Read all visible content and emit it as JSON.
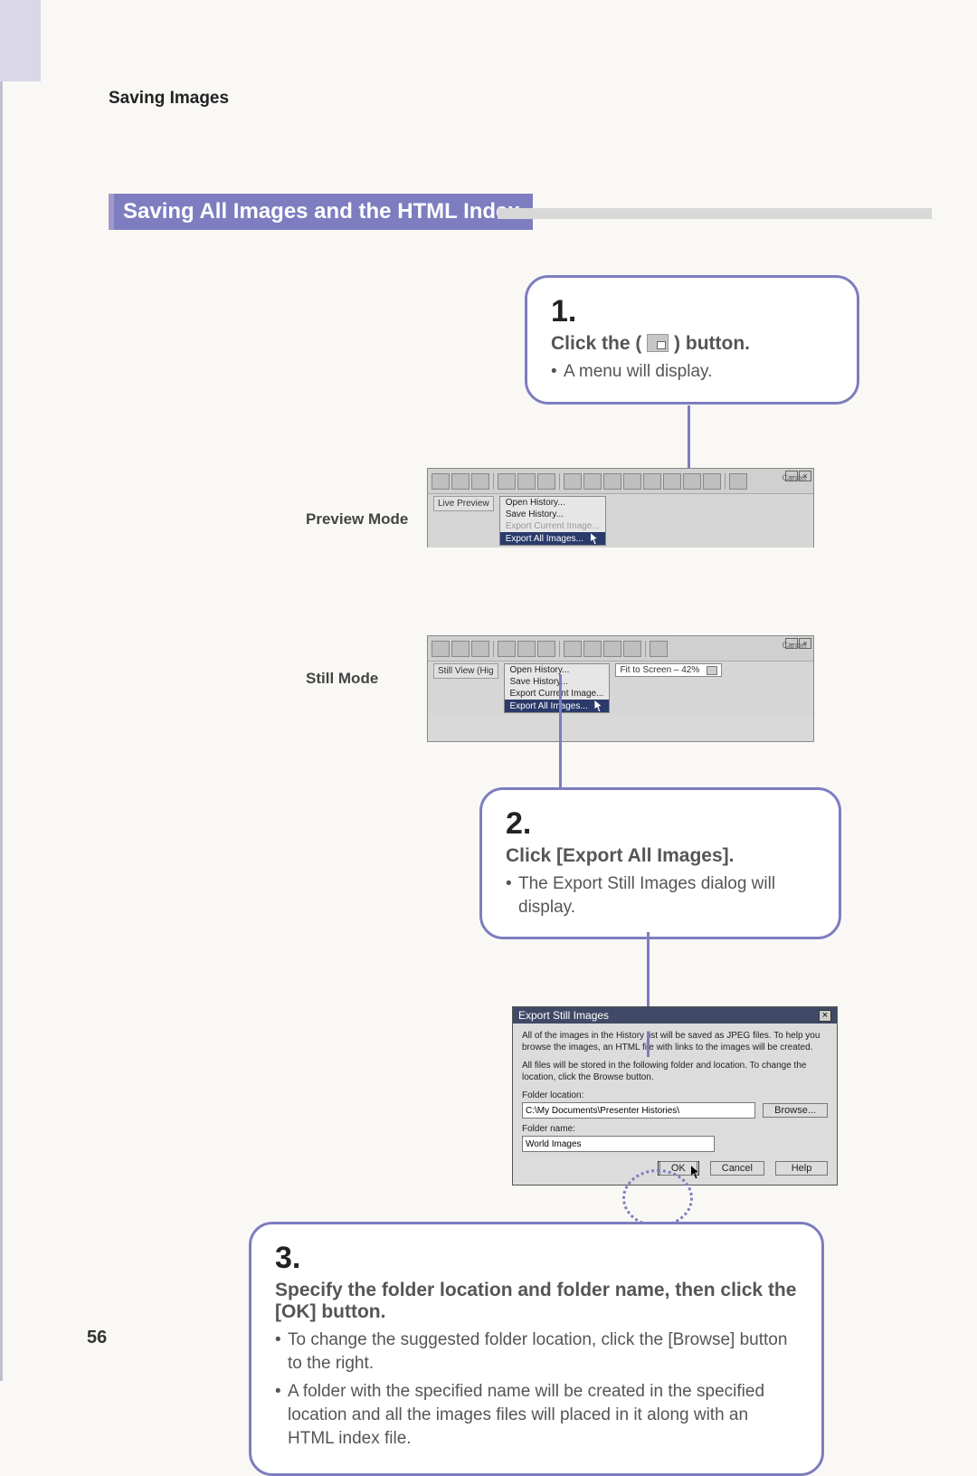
{
  "header_label": "Saving Images",
  "section_title": "Saving All Images and the HTML Index",
  "page_number": "56",
  "step1": {
    "num": "1.",
    "title_pre": "Click the ( ",
    "title_post": " ) button.",
    "bullet": "A menu will display."
  },
  "step2": {
    "num": "2.",
    "title": "Click [Export All Images].",
    "bullet": "The Export Still Images dialog will display."
  },
  "step3": {
    "num": "3.",
    "title": "Specify the folder location and folder name, then click the [OK] button.",
    "b1": "To change the suggested folder location, click the [Browse] button to the right.",
    "b2": "A folder with the specified name will be created in the specified location and all the images files will placed in it along with an HTML index file."
  },
  "mode_labels": {
    "preview": "Preview Mode",
    "still": "Still Mode"
  },
  "toolbar_preview": {
    "brand": "Canon",
    "mode_button": "Live Preview",
    "menu": {
      "open_history": "Open History...",
      "save_history": "Save History...",
      "export_current": "Export Current Image...",
      "export_all": "Export All Images..."
    }
  },
  "toolbar_still": {
    "brand": "Canon",
    "mode_button": "Still View (Hig",
    "fit_label": "Fit to Screen – 42%",
    "menu": {
      "open_history": "Open History...",
      "save_history": "Save History...",
      "export_current": "Export Current Image...",
      "export_all": "Export All Images..."
    }
  },
  "dialog": {
    "title": "Export Still Images",
    "para1": "All of the images in the History list will be saved as JPEG files. To help you browse the images, an HTML file with links to the images will be created.",
    "para2": "All files will be stored in the following folder and location. To change the location, click the Browse button.",
    "folder_location_label": "Folder location:",
    "folder_location_value": "C:\\My Documents\\Presenter Histories\\",
    "browse": "Browse...",
    "folder_name_label": "Folder name:",
    "folder_name_value": "World Images",
    "ok": "OK",
    "cancel": "Cancel",
    "help": "Help"
  }
}
